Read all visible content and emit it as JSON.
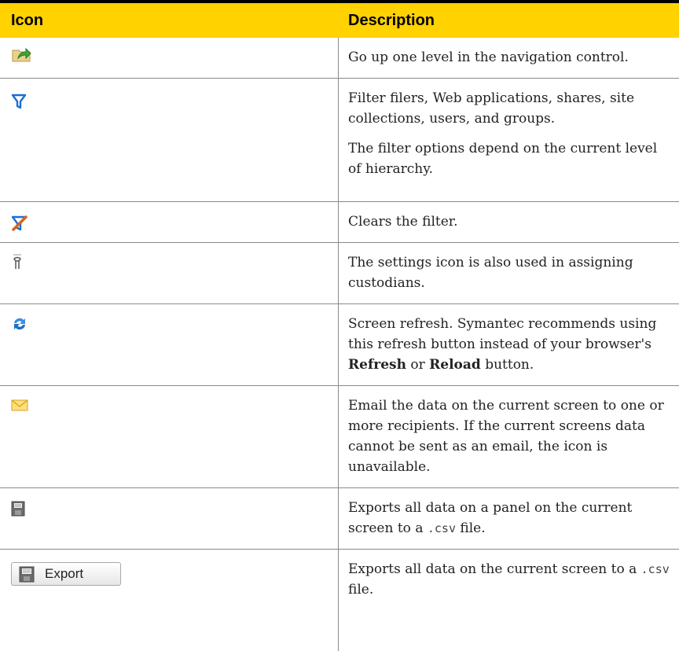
{
  "header": {
    "icon_col": "Icon",
    "desc_col": "Description"
  },
  "rows": [
    {
      "icon": "up-level-icon",
      "text": "Go up one level in the navigation control."
    },
    {
      "icon": "filter-icon",
      "text1": "Filter filers, Web applications, shares, site collections, users, and groups.",
      "text2": "The filter options depend on the current level of hierarchy."
    },
    {
      "icon": "clear-filter-icon",
      "text": "Clears the filter."
    },
    {
      "icon": "settings-icon",
      "text": "The settings icon is also used in assigning custodians."
    },
    {
      "icon": "refresh-icon",
      "text_a": "Screen refresh. Symantec recommends using this refresh button instead of your browser's ",
      "bold1": "Refresh",
      "text_b": " or ",
      "bold2": "Reload",
      "text_c": " button."
    },
    {
      "icon": "email-icon",
      "text": "Email the data on the current screen to one or more recipients. If the current screens data cannot be sent as an email, the icon is unavailable."
    },
    {
      "icon": "save-icon",
      "text_a": "Exports all data on a panel on the current screen to a ",
      "code": ".csv",
      "text_b": " file."
    },
    {
      "icon": "export-button-icon",
      "button_label": "Export",
      "text_a": "Exports all data on the current screen to a ",
      "code": ".csv",
      "text_b": " file."
    }
  ],
  "colors": {
    "header_bg": "#ffd200",
    "rule": "#8a8a8a"
  }
}
